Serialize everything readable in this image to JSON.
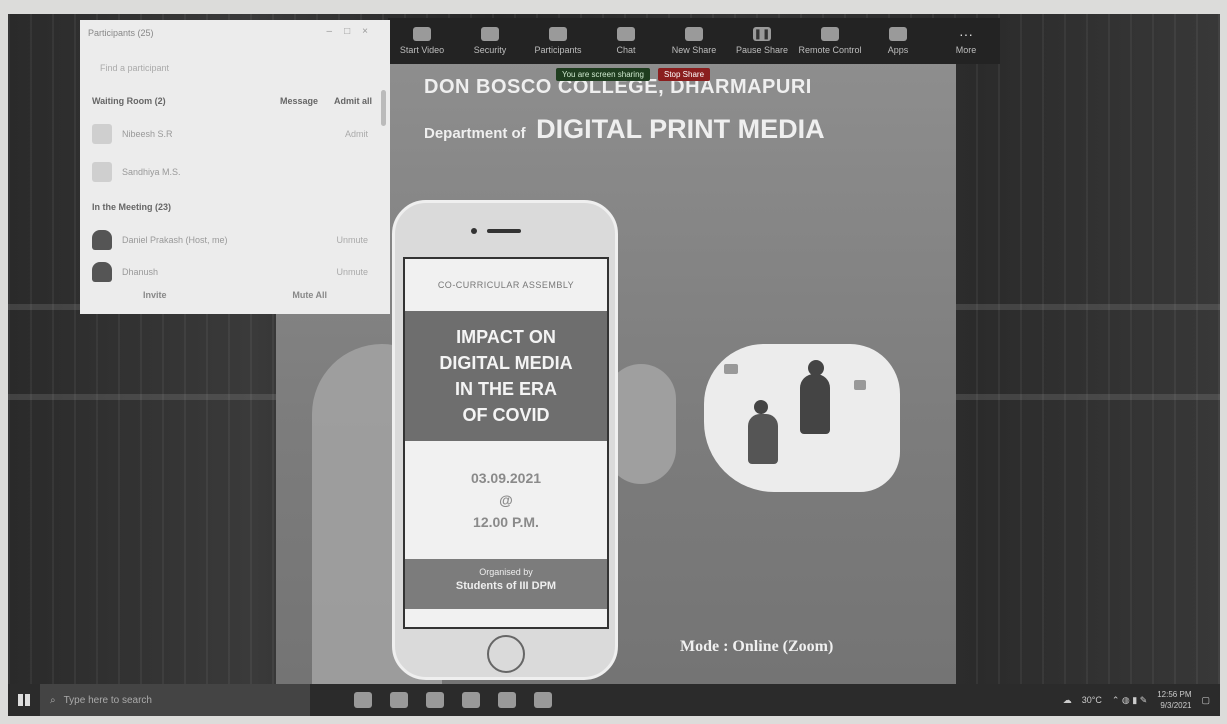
{
  "zoom": {
    "participants_panel": {
      "title": "Participants (25)",
      "search_placeholder": "Find a participant",
      "waiting_room": {
        "label": "Waiting Room (2)",
        "message_label": "Message",
        "admit_all_label": "Admit all",
        "people": [
          {
            "name": "Nibeesh S.R",
            "action": "Admit"
          },
          {
            "name": "Sandhiya M.S.",
            "action": ""
          }
        ]
      },
      "in_meeting": {
        "label": "In the Meeting (23)",
        "people": [
          {
            "name": "Daniel Prakash (Host, me)",
            "action": "Unmute"
          },
          {
            "name": "Dhanush",
            "action": "Unmute"
          }
        ]
      },
      "footer": {
        "invite_label": "Invite",
        "mute_all_label": "Mute All"
      }
    },
    "toolbar": [
      {
        "label": "Start Video",
        "icon": "video-icon"
      },
      {
        "label": "Security",
        "icon": "shield-icon"
      },
      {
        "label": "Participants",
        "icon": "people-icon"
      },
      {
        "label": "Chat",
        "icon": "chat-icon"
      },
      {
        "label": "New Share",
        "icon": "share-icon"
      },
      {
        "label": "Pause Share",
        "icon": "pause-icon"
      },
      {
        "label": "Remote Control",
        "icon": "remote-icon"
      },
      {
        "label": "Apps",
        "icon": "apps-icon"
      },
      {
        "label": "More",
        "icon": "more-icon"
      }
    ],
    "share_status": {
      "text": "You are screen sharing",
      "stop_label": "Stop Share"
    }
  },
  "poster": {
    "college": "DON BOSCO COLLEGE, DHARMAPURI",
    "dept_prefix": "Department of",
    "dept_name": "DIGITAL PRINT MEDIA",
    "phone": {
      "header": "CO-CURRICULAR ASSEMBLY",
      "title_lines": [
        "IMPACT ON",
        "DIGITAL MEDIA",
        "IN THE ERA",
        "OF COVID"
      ],
      "date": "03.09.2021",
      "at": "@",
      "time": "12.00 P.M.",
      "organised_by": "Organised by",
      "organiser": "Students of III DPM"
    },
    "mode": "Mode : Online (Zoom)"
  },
  "taskbar": {
    "search_placeholder": "Type here to search",
    "weather": "30°C",
    "clock_time": "12:56 PM",
    "clock_date": "9/3/2021"
  }
}
